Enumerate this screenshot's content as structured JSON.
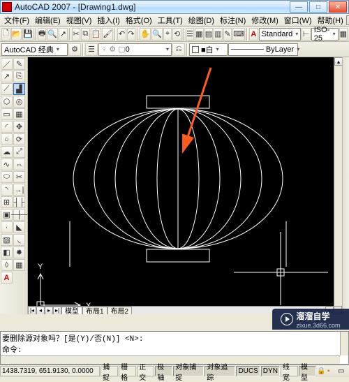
{
  "title": "AutoCAD 2007 - [Drawing1.dwg]",
  "menus": {
    "file": "文件(F)",
    "edit": "编辑(E)",
    "view": "视图(V)",
    "insert": "插入(I)",
    "format": "格式(O)",
    "tools": "工具(T)",
    "draw": "绘图(D)",
    "dim": "标注(N)",
    "modify": "修改(M)",
    "window": "窗口(W)",
    "help": "帮助(H)"
  },
  "workspace": {
    "label": "AutoCAD 经典"
  },
  "layer": {
    "name": "0",
    "state_icon": "●",
    "color": "#ffffff"
  },
  "textstyle": {
    "label": "Standard"
  },
  "dimstyle": {
    "label": "ISO-25"
  },
  "color": {
    "label": "■白"
  },
  "linetype": {
    "label": "ByLayer"
  },
  "tabs": {
    "model": "模型",
    "layout1": "布局1",
    "layout2": "布局2"
  },
  "cmd": {
    "history1": "要删除源对象吗？[是(Y)/否(N)] <N>:",
    "history2": "",
    "prompt": "命令:"
  },
  "status": {
    "coords": "1438.7319, 651.9130, 0.0000",
    "snap": "捕捉",
    "grid": "栅格",
    "ortho": "正交",
    "polar": "极轴",
    "osnap": "对象捕捉",
    "otrack": "对象追踪",
    "ducs": "DUCS",
    "dyn": "DYN",
    "lwt": "线宽",
    "model": "模型"
  },
  "badge": {
    "brand": "溜溜自学",
    "url": "zixue.3d66.com"
  },
  "ucs": {
    "x": "X",
    "y": "Y"
  }
}
